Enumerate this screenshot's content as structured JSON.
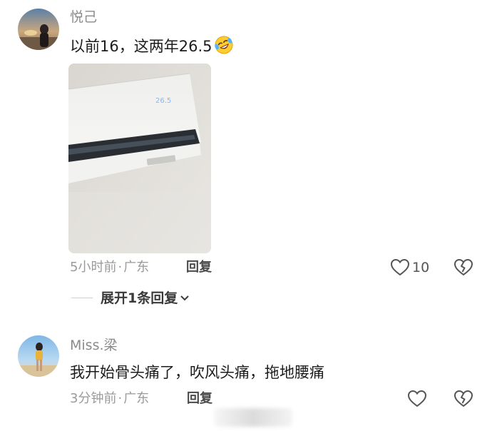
{
  "comments": [
    {
      "username": "悦己",
      "text": "以前16，这两年26.5",
      "emoji_icon": "rofl-face-icon",
      "photo_icon": "air-conditioner-photo",
      "photo_display": "26.5",
      "time": "5小时前",
      "location": "广东",
      "separator": "·",
      "reply_label": "回复",
      "like_count": "10",
      "expand_label": "展开1条回复"
    },
    {
      "username": "Miss.梁",
      "text": "我开始骨头痛了，吹风头痛，拖地腰痛",
      "time": "3分钟前",
      "location": "广东",
      "separator": "·",
      "reply_label": "回复",
      "like_count": ""
    }
  ],
  "colors": {
    "username": "#8a8a8a",
    "text": "#1c1c1c",
    "meta": "#9a9a9a"
  }
}
